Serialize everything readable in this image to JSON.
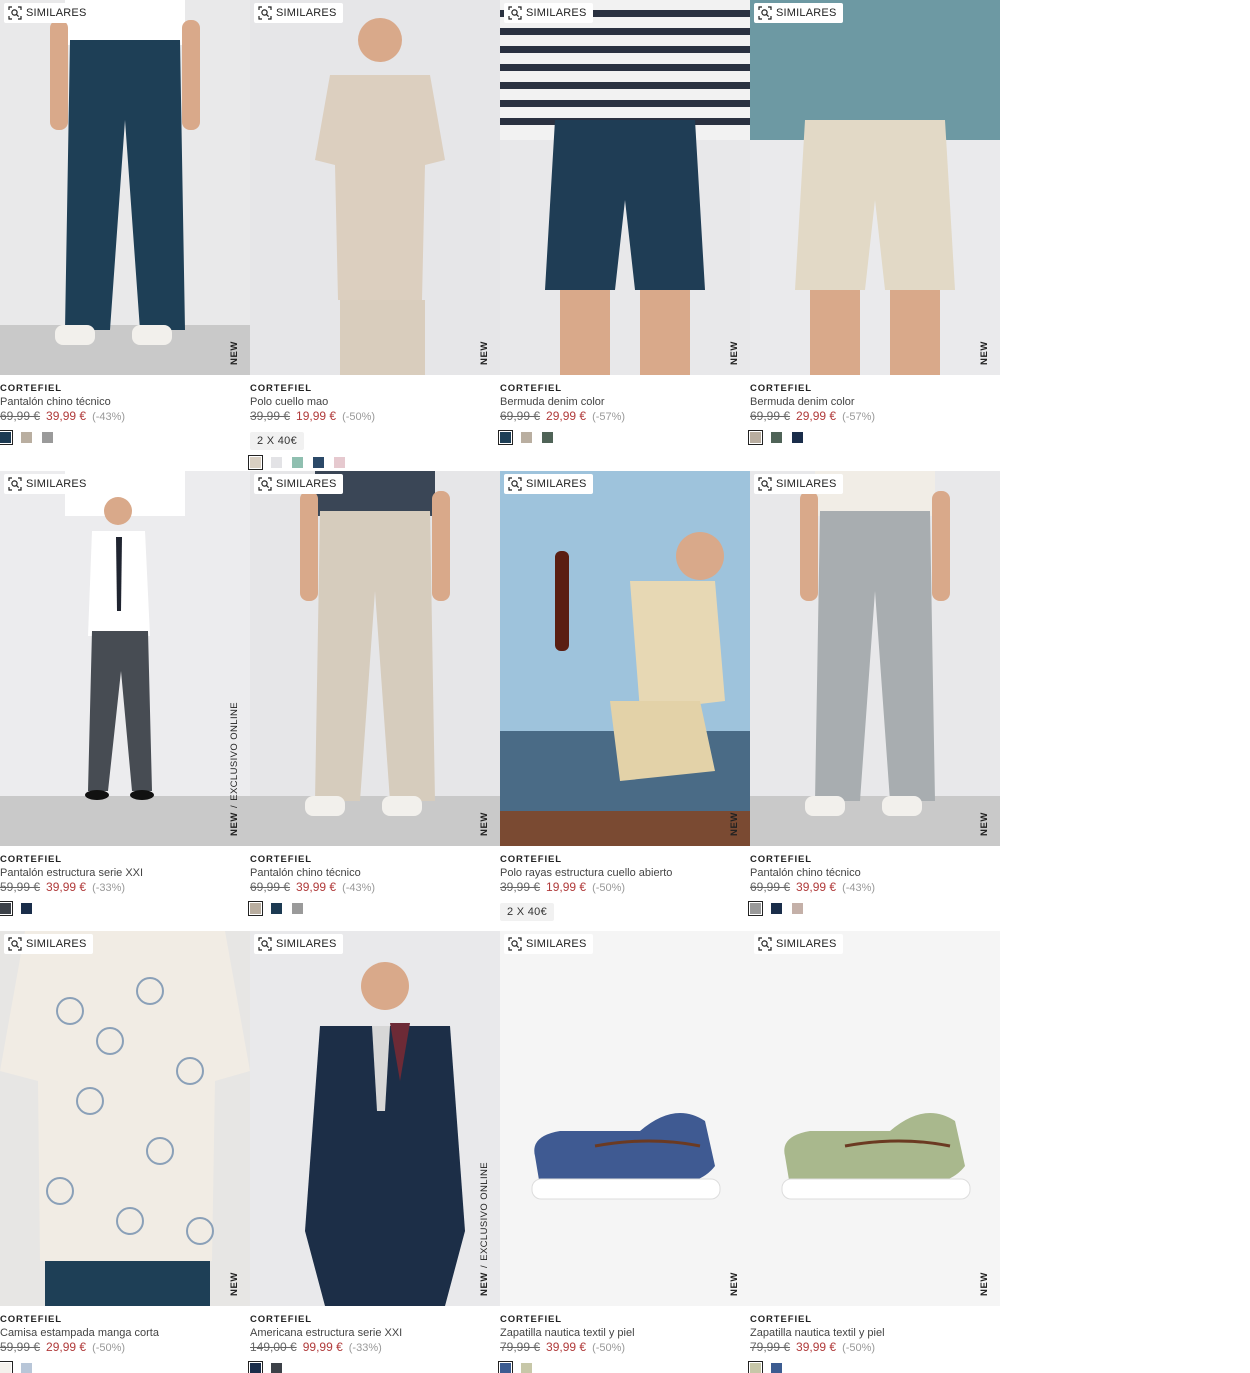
{
  "similares_label": "SIMILARES",
  "products": [
    {
      "brand": "CORTEFIEL",
      "name": "Pantalón chino técnico",
      "old_price": "69,99 €",
      "price": "39,99 €",
      "discount": "(-43%)",
      "tag": "NEW",
      "exclusive": "",
      "promo": "",
      "colors": [
        "#1c3a52",
        "#b9aea0",
        "#9a9a9a"
      ],
      "selected_color": 0,
      "art": "pants",
      "art_colors": {
        "bg": "#e9e9ea",
        "main": "#1e3f56",
        "top": "#ffffff",
        "stripe": "#2a3140"
      }
    },
    {
      "brand": "CORTEFIEL",
      "name": "Polo cuello mao",
      "old_price": "39,99 €",
      "price": "19,99 €",
      "discount": "(-50%)",
      "tag": "NEW",
      "exclusive": "",
      "promo": "2 X 40€",
      "colors": [
        "#d9cfc2",
        "#e3e3e6",
        "#8fbfb0",
        "#2b4968",
        "#e6c9cf"
      ],
      "selected_color": 0,
      "art": "polo",
      "art_colors": {
        "bg": "#e6e6e8",
        "main": "#dccfbf",
        "top": "#d9cdbd",
        "stripe": "#cdbfae"
      }
    },
    {
      "brand": "CORTEFIEL",
      "name": "Bermuda denim color",
      "old_price": "69,99 €",
      "price": "29,99 €",
      "discount": "(-57%)",
      "tag": "NEW",
      "exclusive": "",
      "promo": "",
      "colors": [
        "#1e3f56",
        "#b9aea0",
        "#4f6357"
      ],
      "selected_color": 0,
      "art": "shorts",
      "art_colors": {
        "bg": "#e8e8ea",
        "main": "#1f3d55",
        "top": "#f2f2f2",
        "stripe": "#2a3140"
      }
    },
    {
      "brand": "CORTEFIEL",
      "name": "Bermuda denim color",
      "old_price": "69,99 €",
      "price": "29,99 €",
      "discount": "(-57%)",
      "tag": "NEW",
      "exclusive": "",
      "promo": "",
      "colors": [
        "#b9aea0",
        "#4f6357",
        "#1a2d4a"
      ],
      "selected_color": 0,
      "art": "shorts",
      "art_colors": {
        "bg": "#eaeaec",
        "main": "#e2d9c6",
        "top": "#6d99a3",
        "stripe": "#6d99a3"
      }
    },
    {
      "brand": "CORTEFIEL",
      "name": "Pantalón estructura serie XXI",
      "old_price": "59,99 €",
      "price": "39,99 €",
      "discount": "(-33%)",
      "tag": "NEW",
      "exclusive": "EXCLUSIVO ONLINE",
      "promo": "",
      "colors": [
        "#3c4148",
        "#1a2d4a"
      ],
      "selected_color": 0,
      "art": "suitpants",
      "art_colors": {
        "bg": "#ececee",
        "main": "#474c53",
        "top": "#ffffff",
        "stripe": "#1f2430"
      }
    },
    {
      "brand": "CORTEFIEL",
      "name": "Pantalón chino técnico",
      "old_price": "69,99 €",
      "price": "39,99 €",
      "discount": "(-43%)",
      "tag": "NEW",
      "exclusive": "",
      "promo": "",
      "colors": [
        "#b9aea0",
        "#1c3a52",
        "#9a9a9a"
      ],
      "selected_color": 0,
      "art": "pants",
      "art_colors": {
        "bg": "#e6e6e8",
        "main": "#d6ccbd",
        "top": "#3a4656",
        "stripe": "#3a4656"
      }
    },
    {
      "brand": "CORTEFIEL",
      "name": "Polo rayas estructura cuello abierto",
      "old_price": "39,99 €",
      "price": "19,99 €",
      "discount": "(-50%)",
      "tag": "NEW",
      "exclusive": "",
      "promo": "2 X 40€",
      "colors": [],
      "selected_color": -1,
      "art": "sea",
      "art_colors": {
        "bg": "#9ec3dc",
        "main": "#e7d8b4",
        "top": "#e3d2a8",
        "stripe": "#4a6b86"
      }
    },
    {
      "brand": "CORTEFIEL",
      "name": "Pantalón chino técnico",
      "old_price": "69,99 €",
      "price": "39,99 €",
      "discount": "(-43%)",
      "tag": "NEW",
      "exclusive": "",
      "promo": "",
      "colors": [
        "#9a9a9a",
        "#1a2d4a",
        "#c4b0a8"
      ],
      "selected_color": 0,
      "art": "pants",
      "art_colors": {
        "bg": "#e8e8ea",
        "main": "#a8adb0",
        "top": "#f1ede6",
        "stripe": "#f1ede6"
      }
    },
    {
      "brand": "CORTEFIEL",
      "name": "Camisa estampada manga corta",
      "old_price": "59,99 €",
      "price": "29,99 €",
      "discount": "(-50%)",
      "tag": "NEW",
      "exclusive": "",
      "promo": "",
      "colors": [
        "#f4f1ec",
        "#b8c6d8"
      ],
      "selected_color": 0,
      "art": "shirt",
      "art_colors": {
        "bg": "#e7e6e4",
        "main": "#f1ece4",
        "top": "#8aa0b8",
        "stripe": "#1e3f56"
      }
    },
    {
      "brand": "CORTEFIEL",
      "name": "Americana estructura serie XXI",
      "old_price": "149,00 €",
      "price": "99,99 €",
      "discount": "(-33%)",
      "tag": "NEW",
      "exclusive": "EXCLUSIVO ONLINE",
      "promo": "",
      "colors": [
        "#1a2d4a",
        "#3c4148"
      ],
      "selected_color": 0,
      "art": "blazer",
      "art_colors": {
        "bg": "#e9e9eb",
        "main": "#1c2e47",
        "top": "#6d2a36",
        "stripe": "#d7d7d7"
      }
    },
    {
      "brand": "CORTEFIEL",
      "name": "Zapatilla nautica textil y piel",
      "old_price": "79,99 €",
      "price": "39,99 €",
      "discount": "(-50%)",
      "tag": "NEW",
      "exclusive": "",
      "promo": "",
      "colors": [
        "#3c5c91",
        "#c7c7a8"
      ],
      "selected_color": 0,
      "art": "shoe",
      "art_colors": {
        "bg": "#f5f5f5",
        "main": "#3f5a92",
        "top": "#6b3a22",
        "stripe": "#ffffff"
      }
    },
    {
      "brand": "CORTEFIEL",
      "name": "Zapatilla nautica textil y piel",
      "old_price": "79,99 €",
      "price": "39,99 €",
      "discount": "(-50%)",
      "tag": "NEW",
      "exclusive": "",
      "promo": "",
      "colors": [
        "#c7c7a8",
        "#3c5c91"
      ],
      "selected_color": 0,
      "art": "shoe",
      "art_colors": {
        "bg": "#f5f5f5",
        "main": "#a9b88d",
        "top": "#6b3a22",
        "stripe": "#ffffff"
      }
    }
  ]
}
